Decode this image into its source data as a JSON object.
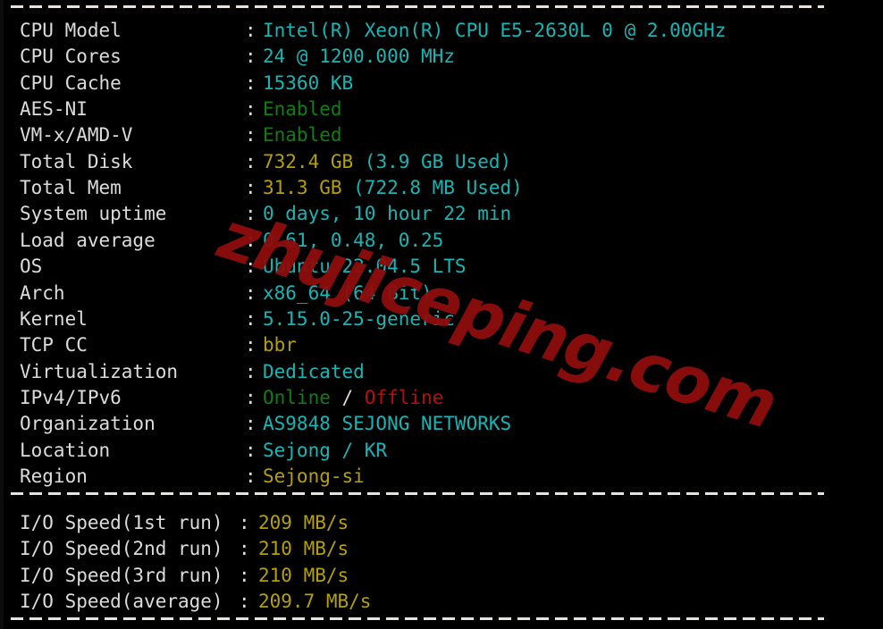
{
  "terminal": {
    "background_color": "#000000",
    "label_color": "#dcdcdc",
    "cyan": "#15b6b6",
    "green": "#0f7d11",
    "yellow": "#b5a000",
    "red": "#c00a0a",
    "separator_char": "-"
  },
  "watermark": {
    "text": "zhujiceping.com",
    "color": "#8f0d0d"
  },
  "separators": {
    "top": "----------------------------------------------------------------------",
    "middle": "----------------------------------------------------------------------",
    "bottom": "----------------------------------------------------------------------"
  },
  "system_info": {
    "colon": ":",
    "rows": [
      {
        "label": "CPU Model",
        "value": "Intel(R) Xeon(R) CPU E5-2630L 0 @ 2.00GHz",
        "color": "c-cyan"
      },
      {
        "label": "CPU Cores",
        "value": "24 @ 1200.000 MHz",
        "color": "c-cyan"
      },
      {
        "label": "CPU Cache",
        "value": "15360 KB",
        "color": "c-cyan"
      },
      {
        "label": "AES-NI",
        "value": "Enabled",
        "color": "c-green"
      },
      {
        "label": "VM-x/AMD-V",
        "value": "Enabled",
        "color": "c-green"
      },
      {
        "label": "Total Disk",
        "value": "732.4 GB",
        "value2": " (3.9 GB Used)",
        "color": "c-yellow",
        "color2": "c-cyan"
      },
      {
        "label": "Total Mem",
        "value": "31.3 GB",
        "value2": " (722.8 MB Used)",
        "color": "c-yellow",
        "color2": "c-cyan"
      },
      {
        "label": "System uptime",
        "value": "0 days, 10 hour 22 min",
        "color": "c-cyan"
      },
      {
        "label": "Load average",
        "value": "0.61, 0.48, 0.25",
        "color": "c-cyan"
      },
      {
        "label": "OS",
        "value": "Ubuntu 22.04.5 LTS",
        "color": "c-cyan"
      },
      {
        "label": "Arch",
        "value": "x86_64 (64 Bit)",
        "color": "c-cyan"
      },
      {
        "label": "Kernel",
        "value": "5.15.0-25-generic",
        "color": "c-cyan"
      },
      {
        "label": "TCP CC",
        "value": "bbr",
        "color": "c-yellow"
      },
      {
        "label": "Virtualization",
        "value": "Dedicated",
        "color": "c-cyan"
      },
      {
        "label": "IPv4/IPv6",
        "value": "Online",
        "value2": " / ",
        "value3": "Offline",
        "color": "c-green",
        "color2": "c-white",
        "color3": "c-red"
      },
      {
        "label": "Organization",
        "value": "AS9848 SEJONG NETWORKS",
        "color": "c-cyan"
      },
      {
        "label": "Location",
        "value": "Sejong / KR",
        "color": "c-cyan"
      },
      {
        "label": "Region",
        "value": "Sejong-si",
        "color": "c-yellow"
      }
    ]
  },
  "io_speed": {
    "colon": ":",
    "rows": [
      {
        "label": "I/O Speed(1st run)",
        "value": "209 MB/s",
        "color": "c-yellow"
      },
      {
        "label": "I/O Speed(2nd run)",
        "value": "210 MB/s",
        "color": "c-yellow"
      },
      {
        "label": "I/O Speed(3rd run)",
        "value": "210 MB/s",
        "color": "c-yellow"
      },
      {
        "label": "I/O Speed(average)",
        "value": "209.7 MB/s",
        "color": "c-yellow"
      }
    ]
  }
}
